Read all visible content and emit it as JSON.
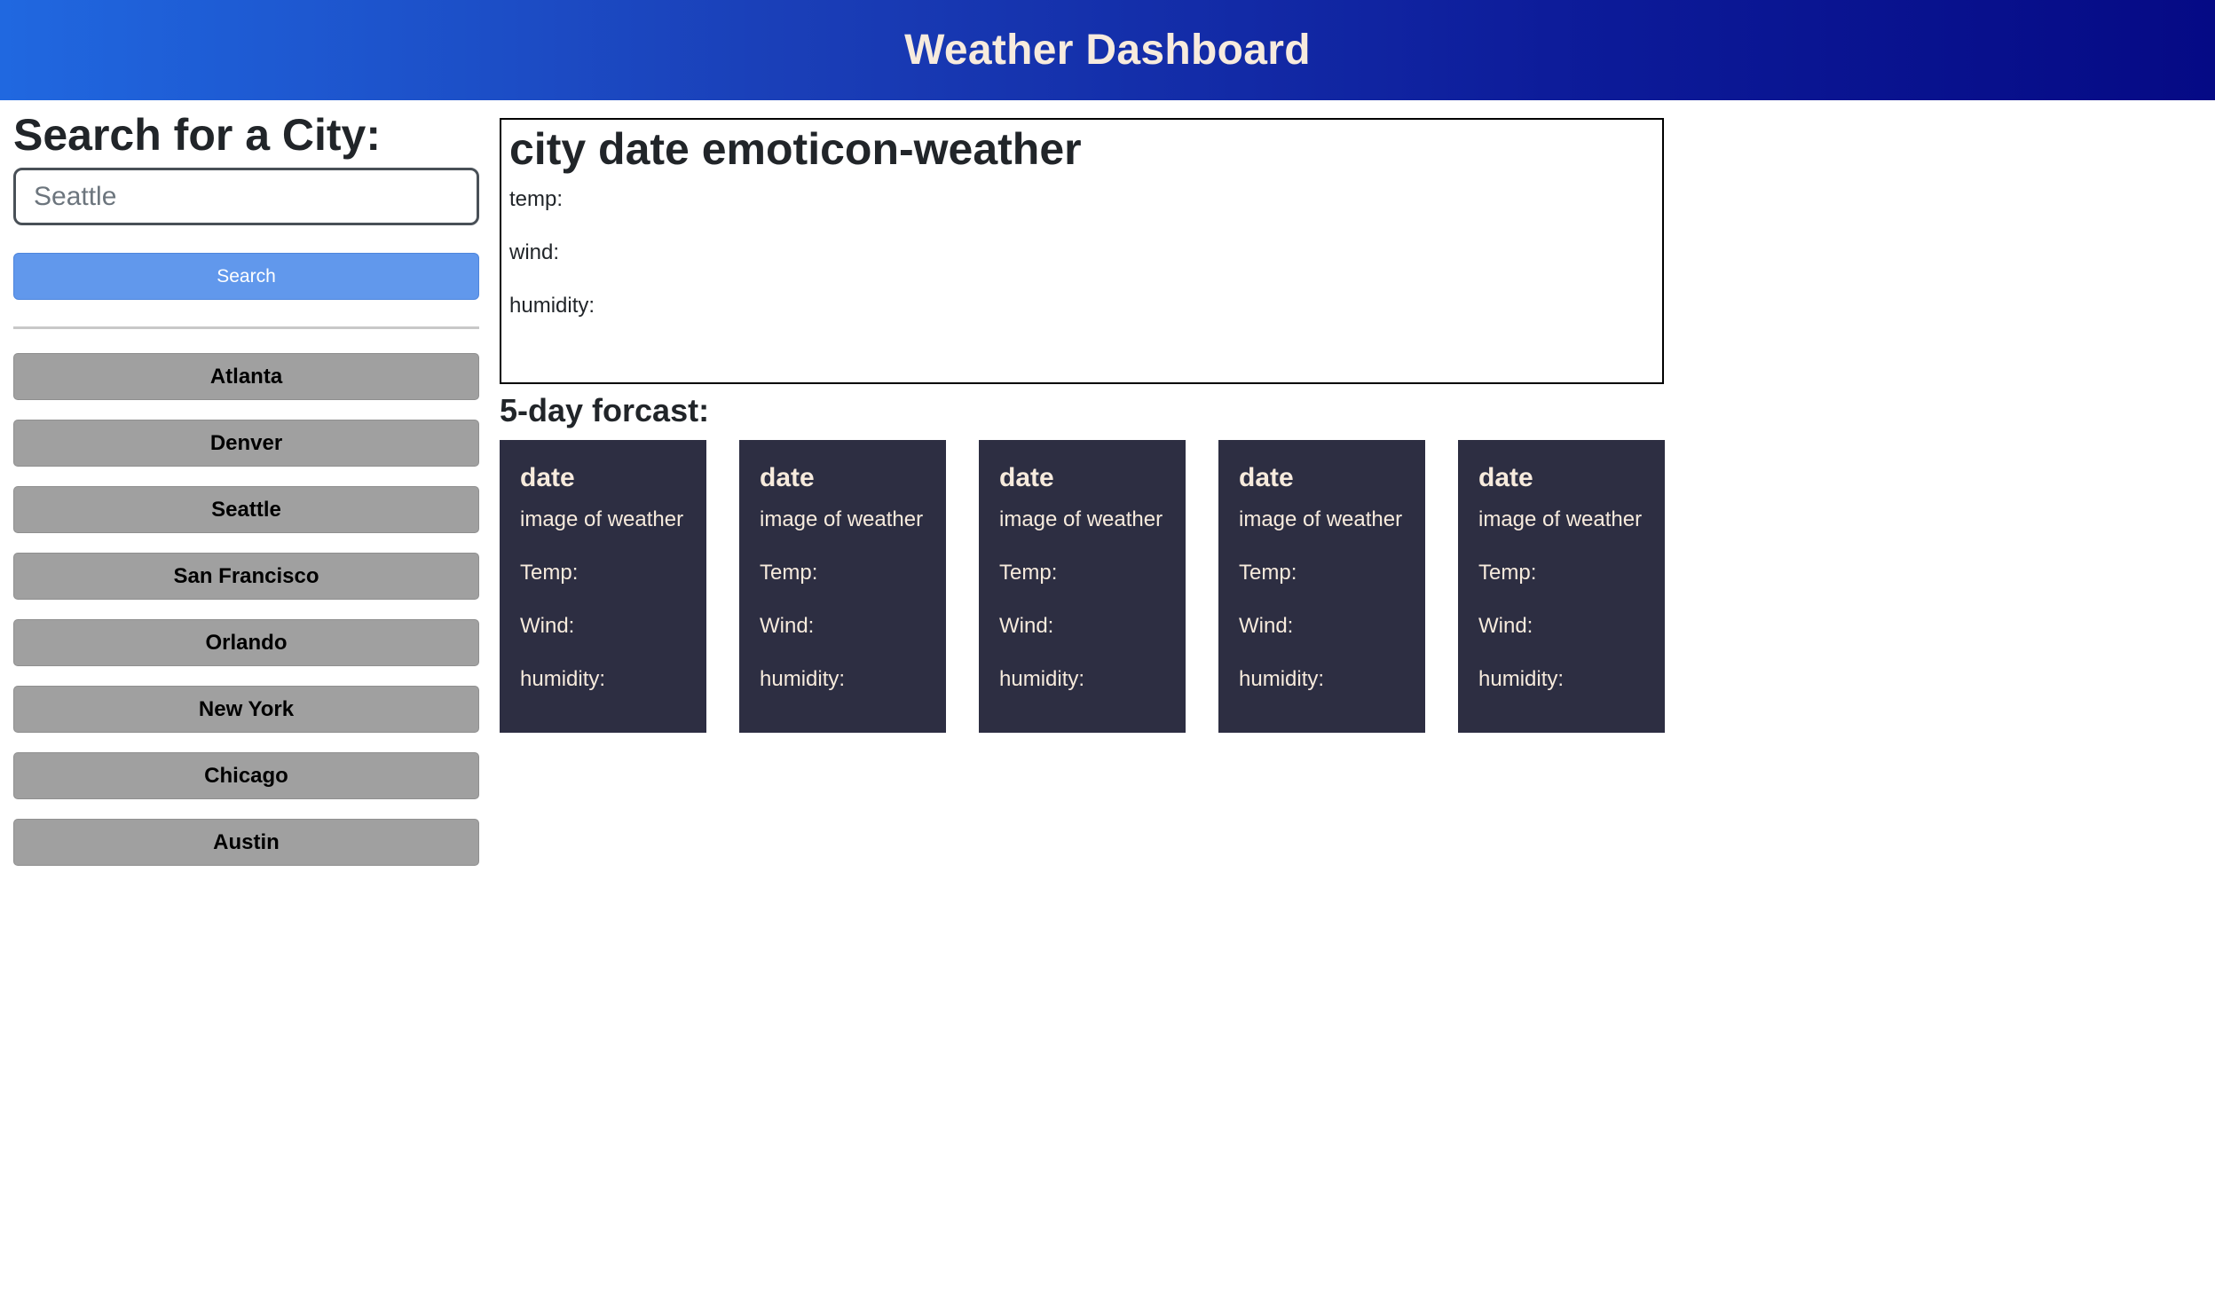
{
  "header": {
    "title": "Weather Dashboard"
  },
  "search": {
    "heading": "Search for a City:",
    "placeholder": "Seattle",
    "button_label": "Search"
  },
  "cities": [
    "Atlanta",
    "Denver",
    "Seattle",
    "San Francisco",
    "Orlando",
    "New York",
    "Chicago",
    "Austin"
  ],
  "current": {
    "title": "city date emoticon-weather",
    "temp_label": "temp:",
    "wind_label": "wind:",
    "humidity_label": "humidity:"
  },
  "forecast": {
    "heading": "5-day forcast:",
    "cards": [
      {
        "date": "date",
        "image": "image of weather",
        "temp": "Temp:",
        "wind": "Wind:",
        "humidity": "humidity:"
      },
      {
        "date": "date",
        "image": "image of weather",
        "temp": "Temp:",
        "wind": "Wind:",
        "humidity": "humidity:"
      },
      {
        "date": "date",
        "image": "image of weather",
        "temp": "Temp:",
        "wind": "Wind:",
        "humidity": "humidity:"
      },
      {
        "date": "date",
        "image": "image of weather",
        "temp": "Temp:",
        "wind": "Wind:",
        "humidity": "humidity:"
      },
      {
        "date": "date",
        "image": "image of weather",
        "temp": "Temp:",
        "wind": "Wind:",
        "humidity": "humidity:"
      }
    ]
  },
  "colors": {
    "header_gradient_start": "#2068e0",
    "header_gradient_end": "#050a85",
    "header_text": "#f7ebdd",
    "search_button": "#6198ec",
    "city_button": "#a0a0a0",
    "card_background": "#2d2e42",
    "card_text": "#f7ebdd"
  }
}
